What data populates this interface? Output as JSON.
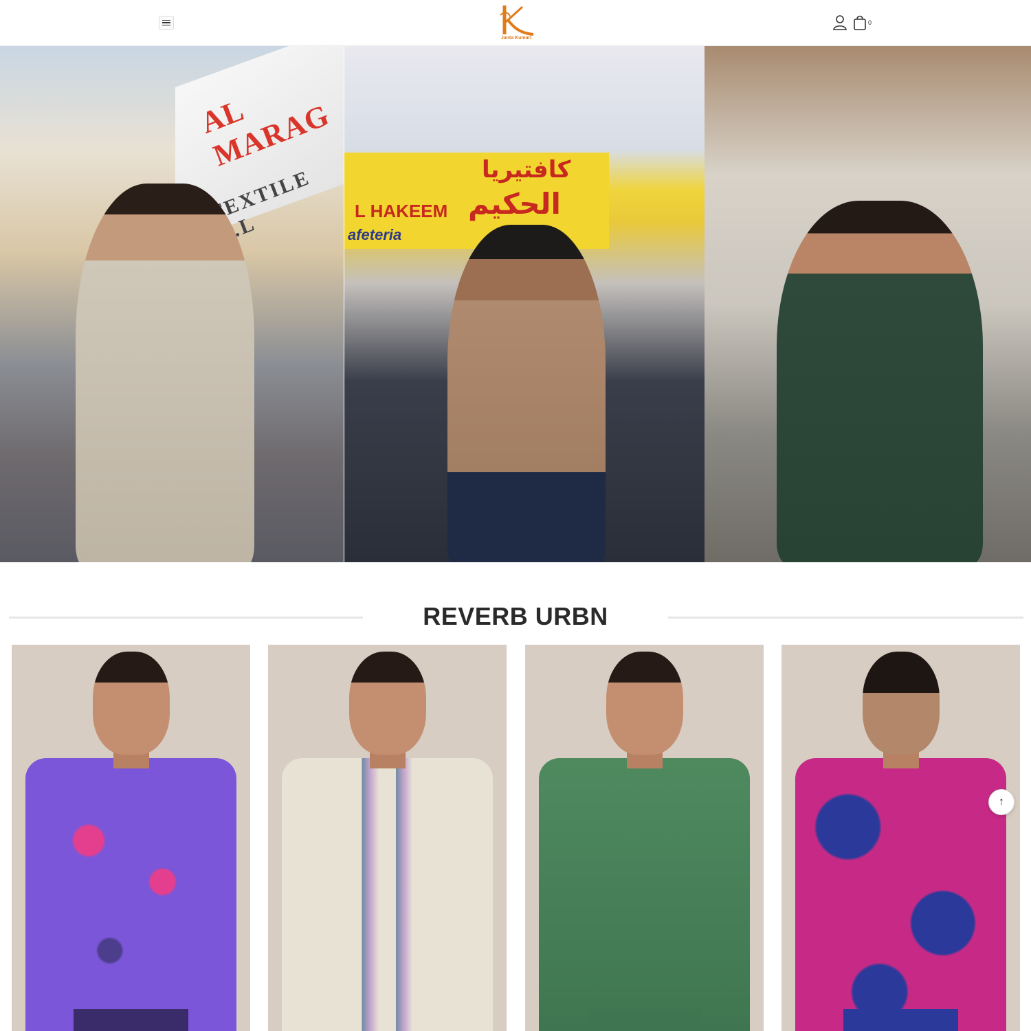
{
  "header": {
    "brand_name": "Janta Kumari",
    "logo_letter": "K",
    "cart_count": "0",
    "icons": {
      "menu": "hamburger-menu-icon",
      "account": "user-icon",
      "cart": "shopping-bag-icon"
    },
    "brand_color": "#e07b1a"
  },
  "hero": {
    "panels": [
      {
        "sign_line1": "AL MARAG",
        "sign_line2": "TEXTILE L.L"
      },
      {
        "sign_line1": "L HAKEEM",
        "sign_line2": "afeteria",
        "arabic_line1": "كافتيريا",
        "arabic_line2": "الحكيم"
      },
      {}
    ]
  },
  "section": {
    "title": "REVERB URBN"
  },
  "scroll_top_icon": "arrow-up-icon"
}
